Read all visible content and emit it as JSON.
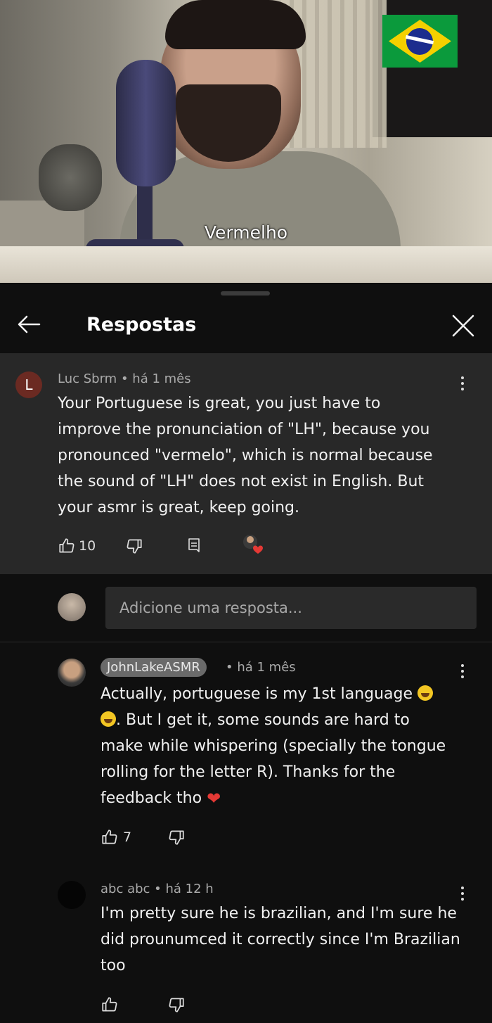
{
  "video": {
    "caption": "Vermelho"
  },
  "panel": {
    "title": "Respostas"
  },
  "parent_comment": {
    "avatar_letter": "L",
    "author": "Luc Sbrm",
    "time": "• há 1 mês",
    "text_lines": [
      "Your Portuguese is great, you just have to",
      "improve the pronunciation of \"LH\", because you",
      "pronounced \"vermelo\", which is normal because",
      "the sound of \"LH\" does not exist in English. But",
      "your asmr is great, keep going."
    ],
    "likes": "10"
  },
  "reply_input": {
    "placeholder": "Adicione uma resposta..."
  },
  "replies": [
    {
      "author": "JohnLakeASMR",
      "time": "• há 1 mês",
      "text_lines": [
        "Actually, portuguese is my 1st language",
        ". But I get it, some sounds are hard to",
        "make while whispering (specially the tongue",
        "rolling for the letter R). Thanks for the",
        "feedback tho"
      ],
      "likes": "7"
    },
    {
      "author": "abc abc",
      "time": "• há 12 h",
      "text_lines": [
        "I'm pretty sure he is brazilian, and I'm sure he",
        "did prounumced it correctly since I'm Brazilian",
        "too"
      ]
    }
  ],
  "icons": {
    "back": "back-arrow-icon",
    "close": "close-icon",
    "like": "thumbs-up-icon",
    "dislike": "thumbs-down-icon",
    "reply": "reply-icon",
    "more": "more-vert-icon",
    "flag": "brazil-flag-icon"
  },
  "colors": {
    "background": "#0f0f0f",
    "parent_bg": "#282828",
    "heart": "#e53935"
  }
}
